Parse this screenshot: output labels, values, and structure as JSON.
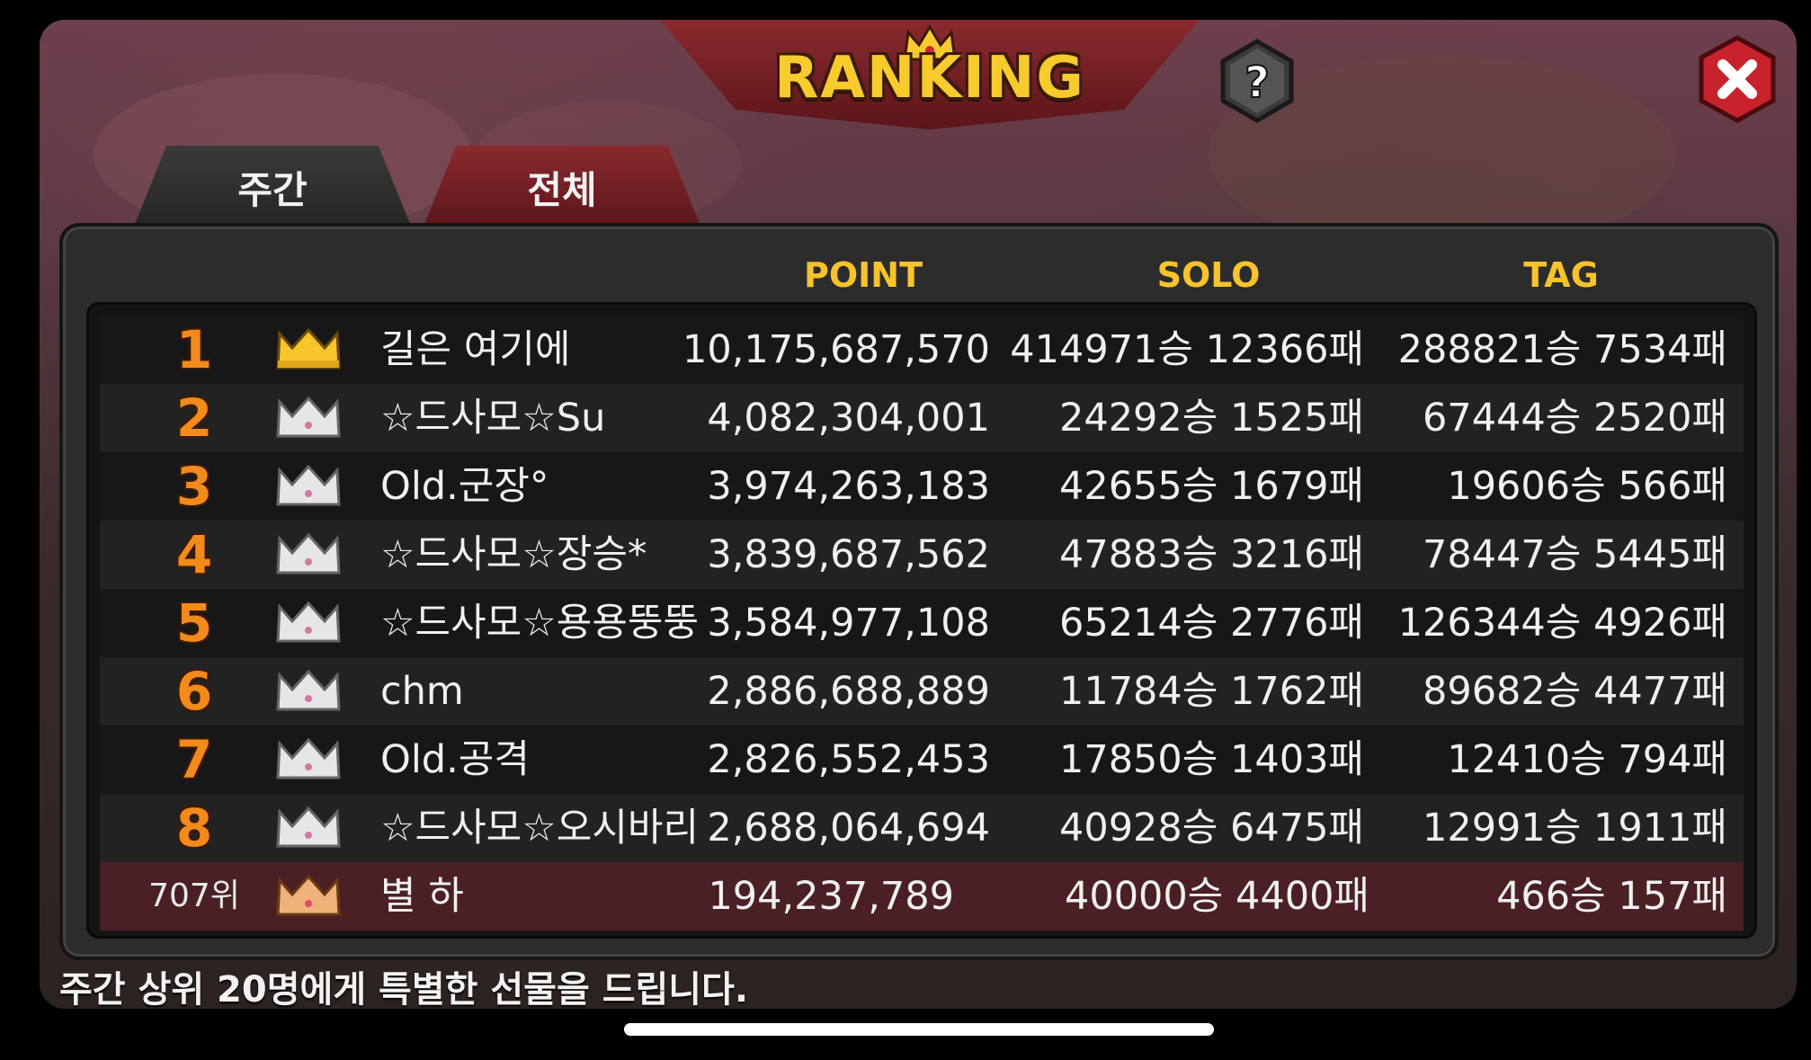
{
  "title": "RANKING",
  "tabs": [
    {
      "label": "주간"
    },
    {
      "label": "전체"
    }
  ],
  "columns": {
    "point": "POINT",
    "solo": "SOLO",
    "tag": "TAG"
  },
  "rows": [
    {
      "rank": "1",
      "crown": "gold-crown-icon",
      "name": "길은 여기에",
      "point": "10,175,687,570",
      "solo": "414971승 12366패",
      "tag": "288821승 7534패"
    },
    {
      "rank": "2",
      "crown": "silver-crown-icon",
      "name": "☆드사모☆Su",
      "point": "4,082,304,001",
      "solo": "24292승 1525패",
      "tag": "67444승 2520패"
    },
    {
      "rank": "3",
      "crown": "silver-crown-icon",
      "name": "Old.군장°",
      "point": "3,974,263,183",
      "solo": "42655승 1679패",
      "tag": "19606승 566패"
    },
    {
      "rank": "4",
      "crown": "silver-crown-icon",
      "name": "☆드사모☆장승*",
      "point": "3,839,687,562",
      "solo": "47883승 3216패",
      "tag": "78447승 5445패"
    },
    {
      "rank": "5",
      "crown": "silver-crown-icon",
      "name": "☆드사모☆용용뚱뚱",
      "point": "3,584,977,108",
      "solo": "65214승 2776패",
      "tag": "126344승 4926패"
    },
    {
      "rank": "6",
      "crown": "silver-crown-icon",
      "name": "chm",
      "point": "2,886,688,889",
      "solo": "11784승 1762패",
      "tag": "89682승 4477패"
    },
    {
      "rank": "7",
      "crown": "silver-crown-icon",
      "name": "Old.공격",
      "point": "2,826,552,453",
      "solo": "17850승 1403패",
      "tag": "12410승 794패"
    },
    {
      "rank": "8",
      "crown": "silver-crown-icon",
      "name": "☆드사모☆오시바리",
      "point": "2,688,064,694",
      "solo": "40928승 6475패",
      "tag": "12991승 1911패"
    }
  ],
  "my_row": {
    "rank": "707위",
    "crown": "bronze-crown-icon",
    "name": "별 하",
    "point": "194,237,789",
    "solo": "40000승 4400패",
    "tag": "466승 157패"
  },
  "footer": "주간 상위 20명에게 특별한 선물을 드립니다.",
  "colors": {
    "accent_gold": "#f6c32c",
    "rank_orange": "#f28a1c",
    "banner_red": "#8a2a2e",
    "my_row_bg": "#4a2024"
  }
}
